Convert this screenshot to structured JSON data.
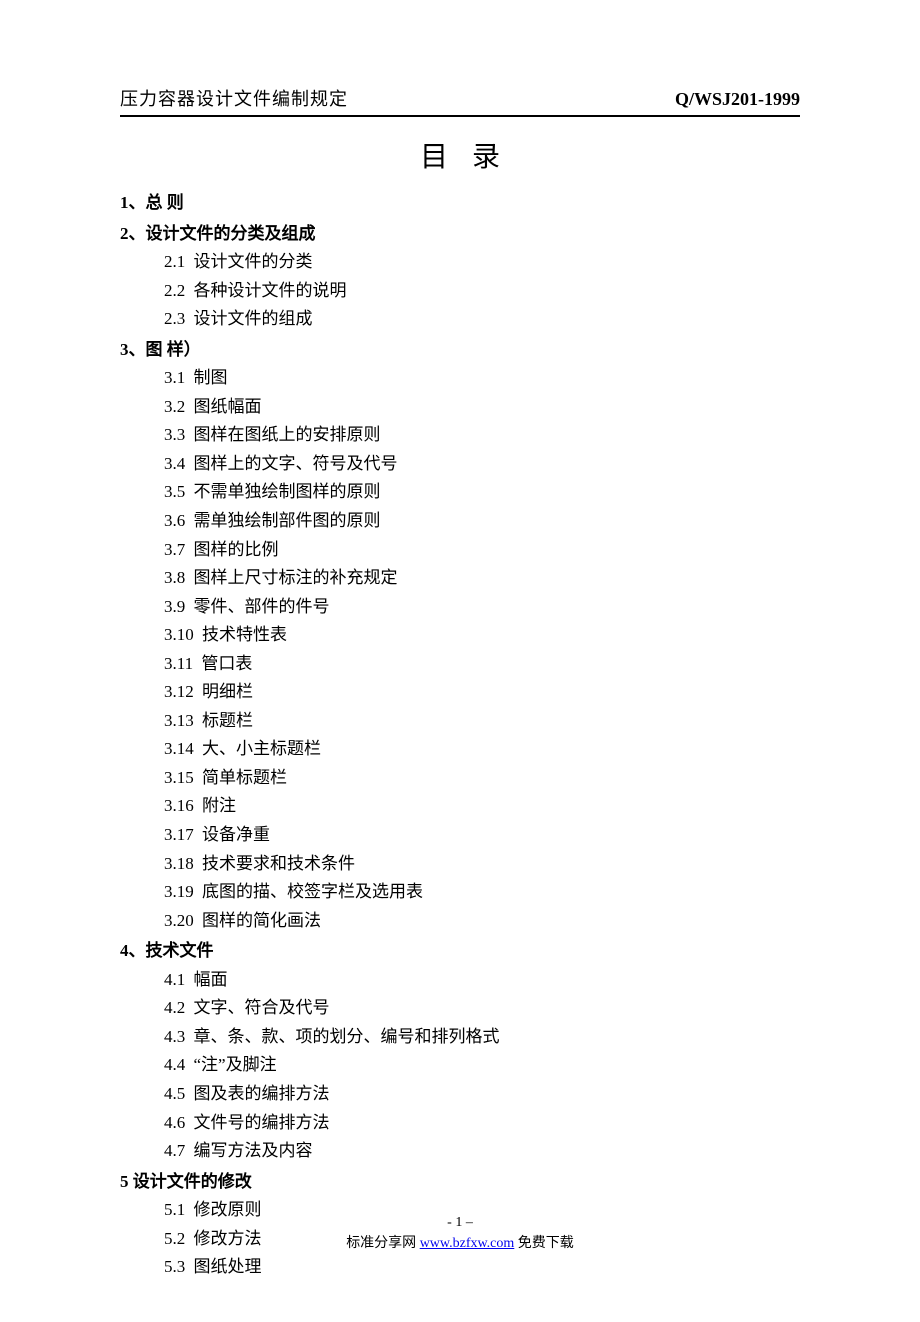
{
  "header": {
    "left": "压力容器设计文件编制规定",
    "right": "Q/WSJ201-1999"
  },
  "title": "目录",
  "sections": [
    {
      "num": "1、",
      "label": "总  则",
      "items": []
    },
    {
      "num": "2、",
      "label": "设计文件的分类及组成",
      "items": [
        {
          "num": "2.1",
          "label": "设计文件的分类"
        },
        {
          "num": "2.2",
          "label": "各种设计文件的说明"
        },
        {
          "num": "2.3",
          "label": "设计文件的组成"
        }
      ]
    },
    {
      "num": "3、",
      "label": "图  样）",
      "items": [
        {
          "num": "3.1",
          "label": "制图"
        },
        {
          "num": "3.2",
          "label": "图纸幅面"
        },
        {
          "num": "3.3",
          "label": "图样在图纸上的安排原则"
        },
        {
          "num": "3.4",
          "label": "图样上的文字、符号及代号"
        },
        {
          "num": "3.5",
          "label": "不需单独绘制图样的原则"
        },
        {
          "num": "3.6",
          "label": "需单独绘制部件图的原则"
        },
        {
          "num": "3.7",
          "label": "图样的比例"
        },
        {
          "num": "3.8",
          "label": "图样上尺寸标注的补充规定"
        },
        {
          "num": "3.9",
          "label": "零件、部件的件号"
        },
        {
          "num": "3.10",
          "label": "技术特性表"
        },
        {
          "num": "3.11",
          "label": "管口表"
        },
        {
          "num": "3.12",
          "label": "明细栏"
        },
        {
          "num": "3.13",
          "label": "标题栏"
        },
        {
          "num": "3.14",
          "label": "大、小主标题栏"
        },
        {
          "num": "3.15",
          "label": "简单标题栏"
        },
        {
          "num": "3.16",
          "label": "附注"
        },
        {
          "num": "3.17",
          "label": "设备净重"
        },
        {
          "num": "3.18",
          "label": "技术要求和技术条件"
        },
        {
          "num": "3.19",
          "label": "底图的描、校签字栏及选用表"
        },
        {
          "num": "3.20",
          "label": "图样的简化画法"
        }
      ]
    },
    {
      "num": "4、",
      "label": "技术文件",
      "items": [
        {
          "num": "4.1",
          "label": "幅面"
        },
        {
          "num": "4.2",
          "label": "文字、符合及代号"
        },
        {
          "num": "4.3",
          "label": "章、条、款、项的划分、编号和排列格式"
        },
        {
          "num": "4.4",
          "label": "“注”及脚注"
        },
        {
          "num": "4.5",
          "label": "图及表的编排方法"
        },
        {
          "num": "4.6",
          "label": "文件号的编排方法"
        },
        {
          "num": "4.7",
          "label": "编写方法及内容"
        }
      ]
    },
    {
      "num": "5 ",
      "label": "设计文件的修改",
      "items": [
        {
          "num": "5.1",
          "label": "修改原则"
        },
        {
          "num": "5.2",
          "label": "修改方法"
        },
        {
          "num": "5.3",
          "label": "图纸处理"
        }
      ]
    }
  ],
  "footer": {
    "page": "- 1 –",
    "share_prefix": "标准分享网 ",
    "share_link": "www.bzfxw.com",
    "share_suffix": " 免费下载"
  }
}
